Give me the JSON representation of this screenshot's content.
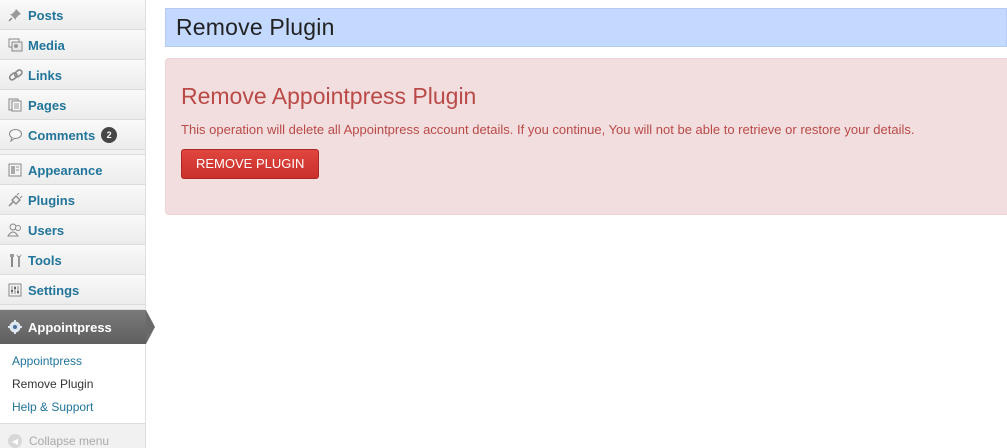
{
  "sidebar": {
    "items": [
      {
        "label": "Posts",
        "icon": "pin-icon"
      },
      {
        "label": "Media",
        "icon": "media-icon"
      },
      {
        "label": "Links",
        "icon": "link-icon"
      },
      {
        "label": "Pages",
        "icon": "pages-icon"
      },
      {
        "label": "Comments",
        "icon": "comment-icon",
        "badge": "2"
      },
      {
        "label": "Appearance",
        "icon": "appearance-icon"
      },
      {
        "label": "Plugins",
        "icon": "plugin-icon"
      },
      {
        "label": "Users",
        "icon": "users-icon"
      },
      {
        "label": "Tools",
        "icon": "tools-icon"
      },
      {
        "label": "Settings",
        "icon": "settings-icon"
      }
    ],
    "active": {
      "label": "Appointpress",
      "icon": "gear-icon"
    },
    "submenu": [
      "Appointpress",
      "Remove Plugin",
      "Help & Support"
    ],
    "collapse_label": "Collapse menu"
  },
  "main": {
    "page_title": "Remove Plugin",
    "alert": {
      "heading": "Remove Appointpress Plugin",
      "message": "This operation will delete all Appointpress account details. If you continue, You will not be able to retrieve or restore your details.",
      "button_label": "REMOVE PLUGIN"
    }
  },
  "colors": {
    "accent_link": "#21759b",
    "alert_text": "#b94a48",
    "alert_bg": "#f2dede",
    "title_bar_bg": "#c4d9ff",
    "button_red": "#da4f49"
  }
}
